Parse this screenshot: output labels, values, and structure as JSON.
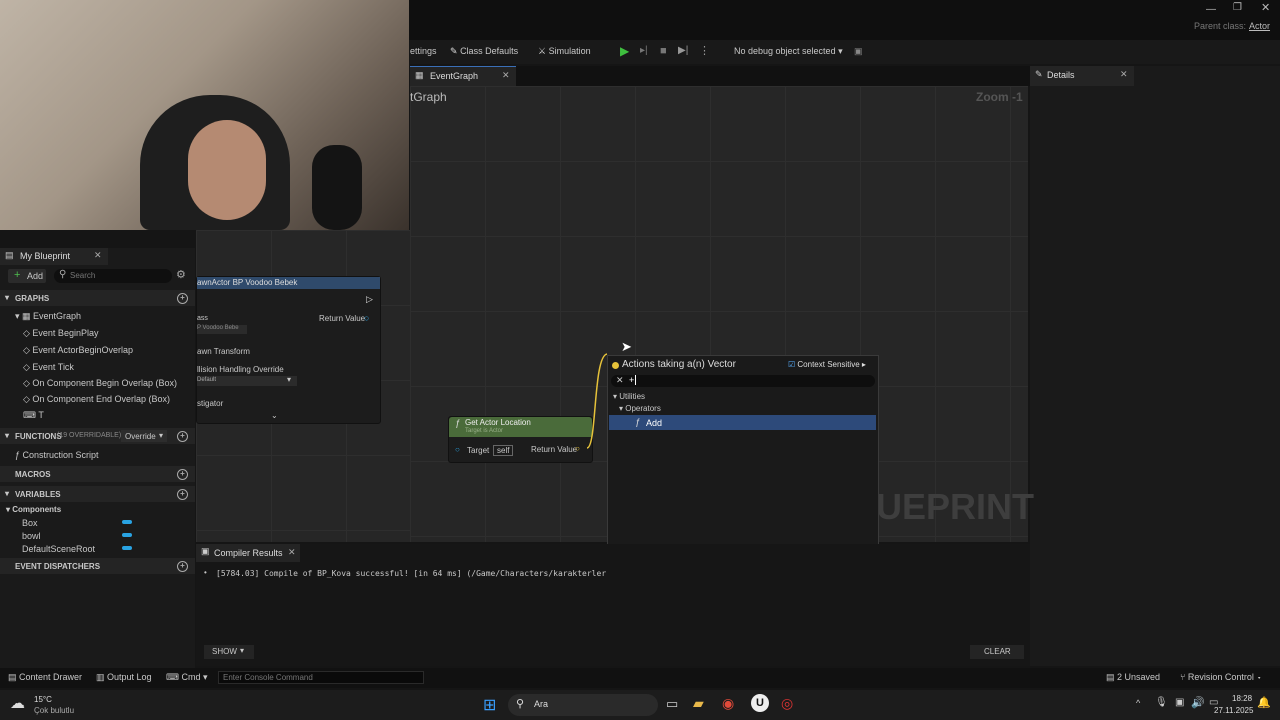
{
  "window": {
    "parent_class_label": "Parent class:",
    "parent_class_value": "Actor"
  },
  "toolbar": {
    "settings": "ettings",
    "class_defaults": "Class Defaults",
    "simulation": "Simulation",
    "debug_object": "No debug object selected"
  },
  "tabs": {
    "event_graph": "EventGraph",
    "details": "Details"
  },
  "graph": {
    "breadcrumb": "tGraph",
    "zoom": "Zoom -1",
    "watermark": "UEPRINT"
  },
  "my_blueprint": {
    "title": "My Blueprint",
    "add": "Add",
    "search_placeholder": "Search",
    "graphs_header": "GRAPHS",
    "event_graph": "EventGraph",
    "events": [
      "Event BeginPlay",
      "Event ActorBeginOverlap",
      "Event Tick",
      "On Component Begin Overlap (Box)",
      "On Component End Overlap (Box)",
      "T"
    ],
    "functions_header": "FUNCTIONS",
    "functions_count": "(19 OVERRIDABLE)",
    "override": "Override",
    "construction_script": "Construction Script",
    "macros_header": "MACROS",
    "variables_header": "VARIABLES",
    "components_label": "Components",
    "components": [
      "Box",
      "bowl",
      "DefaultSceneRoot"
    ],
    "dispatchers_header": "EVENT DISPATCHERS"
  },
  "spawn_node": {
    "title": "awnActor BP Voodoo Bebek",
    "return_value": "Return Value",
    "class_label": "ass",
    "class_value": "P Voodoo Bebe",
    "transform": "awn Transform",
    "collision": "llision Handling Override",
    "collision_value": "Default",
    "instigator": "stigator"
  },
  "location_node": {
    "title": "Get Actor Location",
    "subtitle": "Target is Actor",
    "target": "Target",
    "self": "self",
    "return_value": "Return Value"
  },
  "action_menu": {
    "title": "Actions taking a(n) Vector",
    "context_sensitive": "Context Sensitive",
    "search_value": "+",
    "categories": [
      "Utilities",
      "Operators"
    ],
    "selected_item": "Add"
  },
  "compiler": {
    "title": "Compiler Results",
    "message": "[5784.03] Compile of BP_Kova successful! [in 64 ms] (/Game/Characters/karakterler/dc",
    "show": "SHOW",
    "clear": "CLEAR"
  },
  "statusbar": {
    "content_drawer": "Content Drawer",
    "output_log": "Output Log",
    "cmd": "Cmd",
    "console_placeholder": "Enter Console Command",
    "unsaved": "2 Unsaved",
    "revision_control": "Revision Control"
  },
  "taskbar": {
    "temperature": "15°C",
    "weather": "Çok bulutlu",
    "search": "Ara",
    "time": "18:28",
    "date": "27.11.2025"
  },
  "colors": {
    "accent_selected": "#2d4a7a",
    "node_header_green": "#4a6b3a",
    "node_header_blue": "#2f4a6b",
    "pin_blue": "#29a3e3",
    "pin_yellow": "#e6c23a"
  }
}
